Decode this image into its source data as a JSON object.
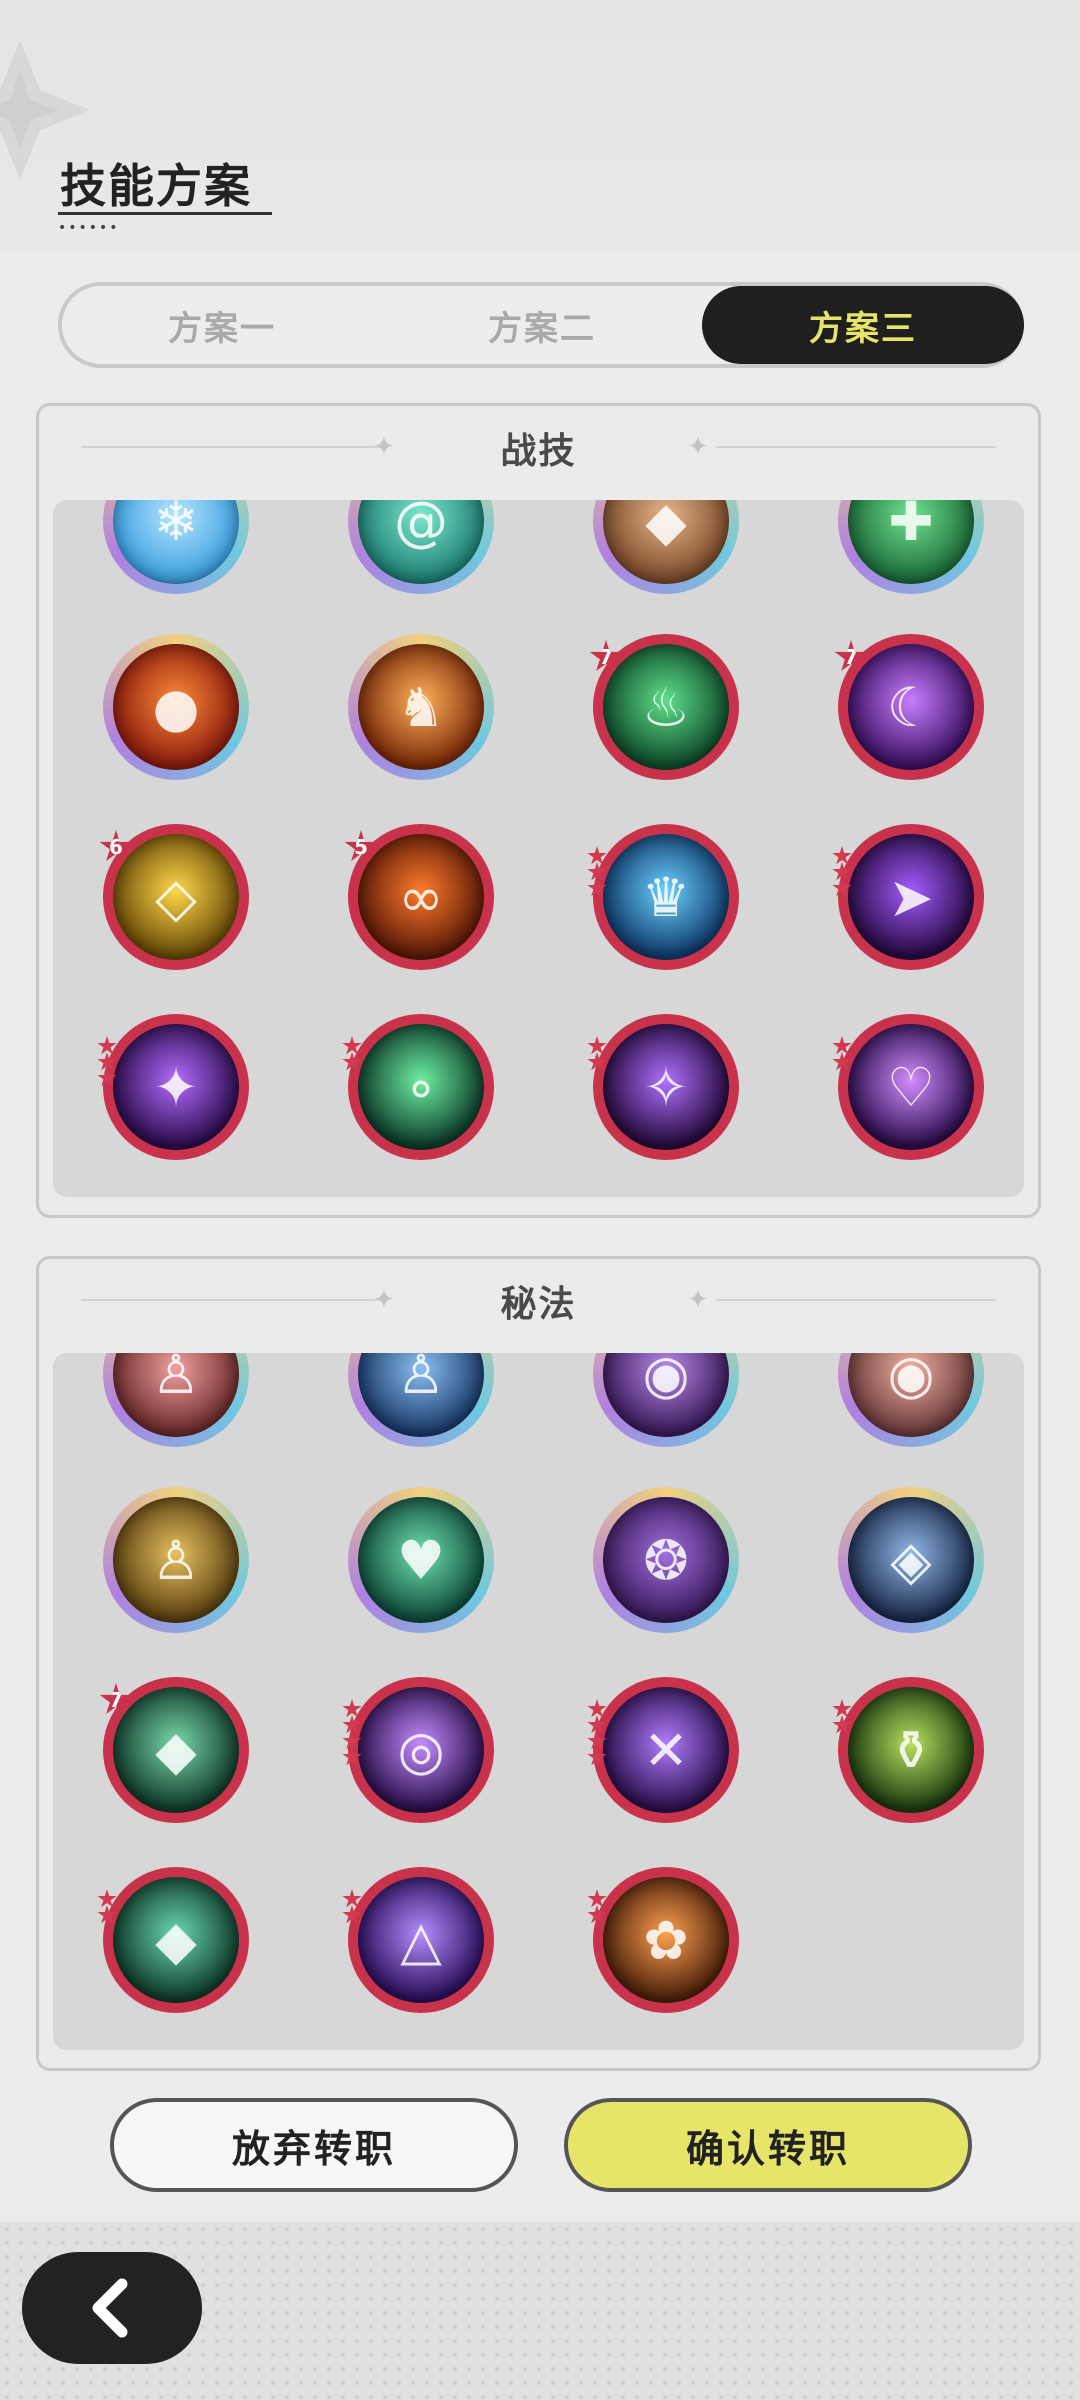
{
  "header": {
    "title": "技能方案"
  },
  "tabs": [
    {
      "label": "方案一",
      "active": false
    },
    {
      "label": "方案二",
      "active": false
    },
    {
      "label": "方案三",
      "active": true
    }
  ],
  "combat": {
    "title": "战技",
    "skills": [
      {
        "icon": "ice-burst-icon",
        "badge": null,
        "stars": 0
      },
      {
        "icon": "wind-vortex-icon",
        "badge": null,
        "stars": 0
      },
      {
        "icon": "earth-rock-icon",
        "badge": null,
        "stars": 0
      },
      {
        "icon": "heal-plus-icon",
        "badge": null,
        "stars": 0
      },
      {
        "icon": "fireball-icon",
        "badge": null,
        "stars": 0
      },
      {
        "icon": "fire-wolf-icon",
        "badge": null,
        "stars": 0
      },
      {
        "icon": "green-flame-icon",
        "badge": "7",
        "stars": 0
      },
      {
        "icon": "purple-swirl-icon",
        "badge": "7",
        "stars": 0
      },
      {
        "icon": "golden-crystal-icon",
        "badge": "6",
        "stars": 0
      },
      {
        "icon": "fire-swirl-icon",
        "badge": "5",
        "stars": 0
      },
      {
        "icon": "ice-golem-icon",
        "badge": null,
        "stars": 3
      },
      {
        "icon": "shadow-slash-icon",
        "badge": null,
        "stars": 3
      },
      {
        "icon": "arcane-bolt-icon",
        "badge": null,
        "stars": 3
      },
      {
        "icon": "nature-bubbles-icon",
        "badge": null,
        "stars": 2
      },
      {
        "icon": "arcane-sigil-icon",
        "badge": null,
        "stars": 2
      },
      {
        "icon": "arcane-wings-icon",
        "badge": null,
        "stars": 2
      }
    ]
  },
  "secret": {
    "title": "秘法",
    "skills": [
      {
        "icon": "red-spirit-icon",
        "badge": null,
        "stars": 0
      },
      {
        "icon": "blue-spirit-icon",
        "badge": null,
        "stars": 0
      },
      {
        "icon": "purple-orb-icon",
        "badge": null,
        "stars": 0
      },
      {
        "icon": "pink-orb-icon",
        "badge": null,
        "stars": 0
      },
      {
        "icon": "gold-pray-icon",
        "badge": null,
        "stars": 0
      },
      {
        "icon": "green-heart-icon",
        "badge": null,
        "stars": 0
      },
      {
        "icon": "purple-rune-icon",
        "badge": null,
        "stars": 0
      },
      {
        "icon": "blue-gem-icon",
        "badge": null,
        "stars": 0
      },
      {
        "icon": "green-stones-icon",
        "badge": "7",
        "stars": 0
      },
      {
        "icon": "purple-eye-icon",
        "badge": null,
        "stars": 4
      },
      {
        "icon": "purple-blade-icon",
        "badge": null,
        "stars": 4
      },
      {
        "icon": "green-potion-icon",
        "badge": null,
        "stars": 2
      },
      {
        "icon": "green-rock-icon",
        "badge": null,
        "stars": 2
      },
      {
        "icon": "purple-triangle-icon",
        "badge": null,
        "stars": 2
      },
      {
        "icon": "orange-flower-icon",
        "badge": null,
        "stars": 2
      }
    ]
  },
  "buttons": {
    "cancel": "放弃转职",
    "confirm": "确认转职"
  },
  "colors": {
    "active_tab_bg": "#1f1f1f",
    "active_tab_text": "#e6e56a",
    "confirm_bg": "#e6e56a",
    "ring_red": "#c8334b"
  }
}
